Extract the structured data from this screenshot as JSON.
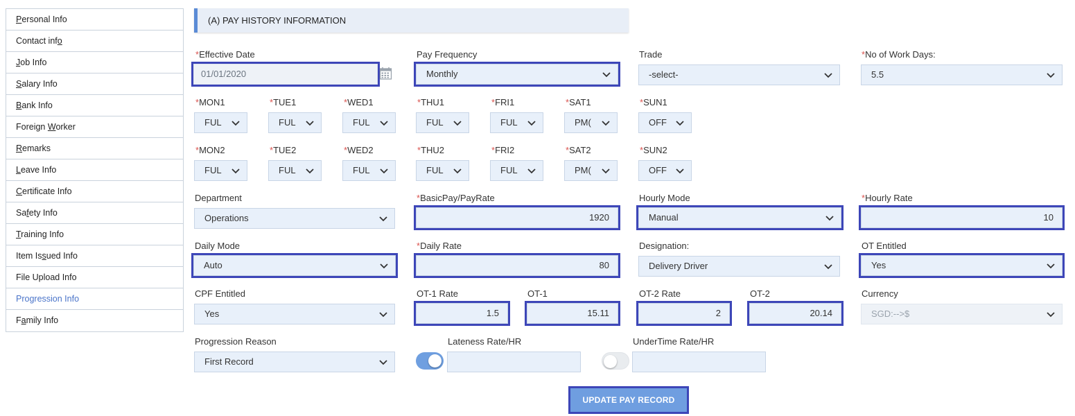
{
  "sidebar": {
    "items": [
      {
        "pre": "",
        "ul": "P",
        "post": "ersonal Info"
      },
      {
        "pre": "Contact inf",
        "ul": "o",
        "post": ""
      },
      {
        "pre": "",
        "ul": "J",
        "post": "ob Info"
      },
      {
        "pre": "",
        "ul": "S",
        "post": "alary Info"
      },
      {
        "pre": "",
        "ul": "B",
        "post": "ank Info"
      },
      {
        "pre": "Foreign ",
        "ul": "W",
        "post": "orker"
      },
      {
        "pre": "",
        "ul": "R",
        "post": "emarks"
      },
      {
        "pre": "",
        "ul": "L",
        "post": "eave Info"
      },
      {
        "pre": "",
        "ul": "C",
        "post": "ertificate Info"
      },
      {
        "pre": "Sa",
        "ul": "f",
        "post": "ety Info"
      },
      {
        "pre": "",
        "ul": "T",
        "post": "raining Info"
      },
      {
        "pre": "Item Is",
        "ul": "s",
        "post": "ued Info"
      },
      {
        "pre": "File Upload Info",
        "ul": "",
        "post": ""
      },
      {
        "pre": "Progression Info",
        "ul": "",
        "post": ""
      },
      {
        "pre": "F",
        "ul": "a",
        "post": "mily Info"
      }
    ]
  },
  "header": {
    "title": "(A) PAY HISTORY INFORMATION"
  },
  "effective_date": {
    "label": "Effective Date",
    "value": "01/01/2020"
  },
  "pay_frequency": {
    "label": "Pay Frequency",
    "value": "Monthly"
  },
  "trade": {
    "label": "Trade",
    "value": "-select-"
  },
  "work_days": {
    "label": "No of Work Days:",
    "value": "5.5"
  },
  "week1": {
    "days": [
      {
        "label": "MON1",
        "value": "FUL"
      },
      {
        "label": "TUE1",
        "value": "FUL"
      },
      {
        "label": "WED1",
        "value": "FUL"
      },
      {
        "label": "THU1",
        "value": "FUL"
      },
      {
        "label": "FRI1",
        "value": "FUL"
      },
      {
        "label": "SAT1",
        "value": "PM("
      },
      {
        "label": "SUN1",
        "value": "OFF"
      }
    ]
  },
  "week2": {
    "days": [
      {
        "label": "MON2",
        "value": "FUL"
      },
      {
        "label": "TUE2",
        "value": "FUL"
      },
      {
        "label": "WED2",
        "value": "FUL"
      },
      {
        "label": "THU2",
        "value": "FUL"
      },
      {
        "label": "FRI2",
        "value": "FUL"
      },
      {
        "label": "SAT2",
        "value": "PM("
      },
      {
        "label": "SUN2",
        "value": "OFF"
      }
    ]
  },
  "department": {
    "label": "Department",
    "value": "Operations"
  },
  "basic_pay": {
    "label": "BasicPay/PayRate",
    "value": "1920"
  },
  "hourly_mode": {
    "label": "Hourly Mode",
    "value": "Manual"
  },
  "hourly_rate": {
    "label": "Hourly Rate",
    "value": "10"
  },
  "daily_mode": {
    "label": "Daily Mode",
    "value": "Auto"
  },
  "daily_rate": {
    "label": "Daily Rate",
    "value": "80"
  },
  "designation": {
    "label": "Designation:",
    "value": "Delivery Driver"
  },
  "ot_entitled": {
    "label": "OT Entitled",
    "value": "Yes"
  },
  "cpf_entitled": {
    "label": "CPF Entitled",
    "value": "Yes"
  },
  "ot1_rate": {
    "label": "OT-1 Rate",
    "value": "1.5"
  },
  "ot1": {
    "label": "OT-1",
    "value": "15.11"
  },
  "ot2_rate": {
    "label": "OT-2 Rate",
    "value": "2"
  },
  "ot2": {
    "label": "OT-2",
    "value": "20.14"
  },
  "currency": {
    "label": "Currency",
    "value": "SGD:-->$"
  },
  "progression_reason": {
    "label": "Progression Reason",
    "value": "First Record"
  },
  "lateness": {
    "label": "Lateness Rate/HR",
    "value": "",
    "toggle_on": true
  },
  "undertime": {
    "label": "UnderTime Rate/HR",
    "value": "",
    "toggle_on": false
  },
  "update_button": {
    "label": "UPDATE PAY RECORD"
  },
  "colors": {
    "accent": "#6f9ee0",
    "highlight": "#3d46b8",
    "required": "#d9534f",
    "field_bg": "#e8f0fa"
  }
}
